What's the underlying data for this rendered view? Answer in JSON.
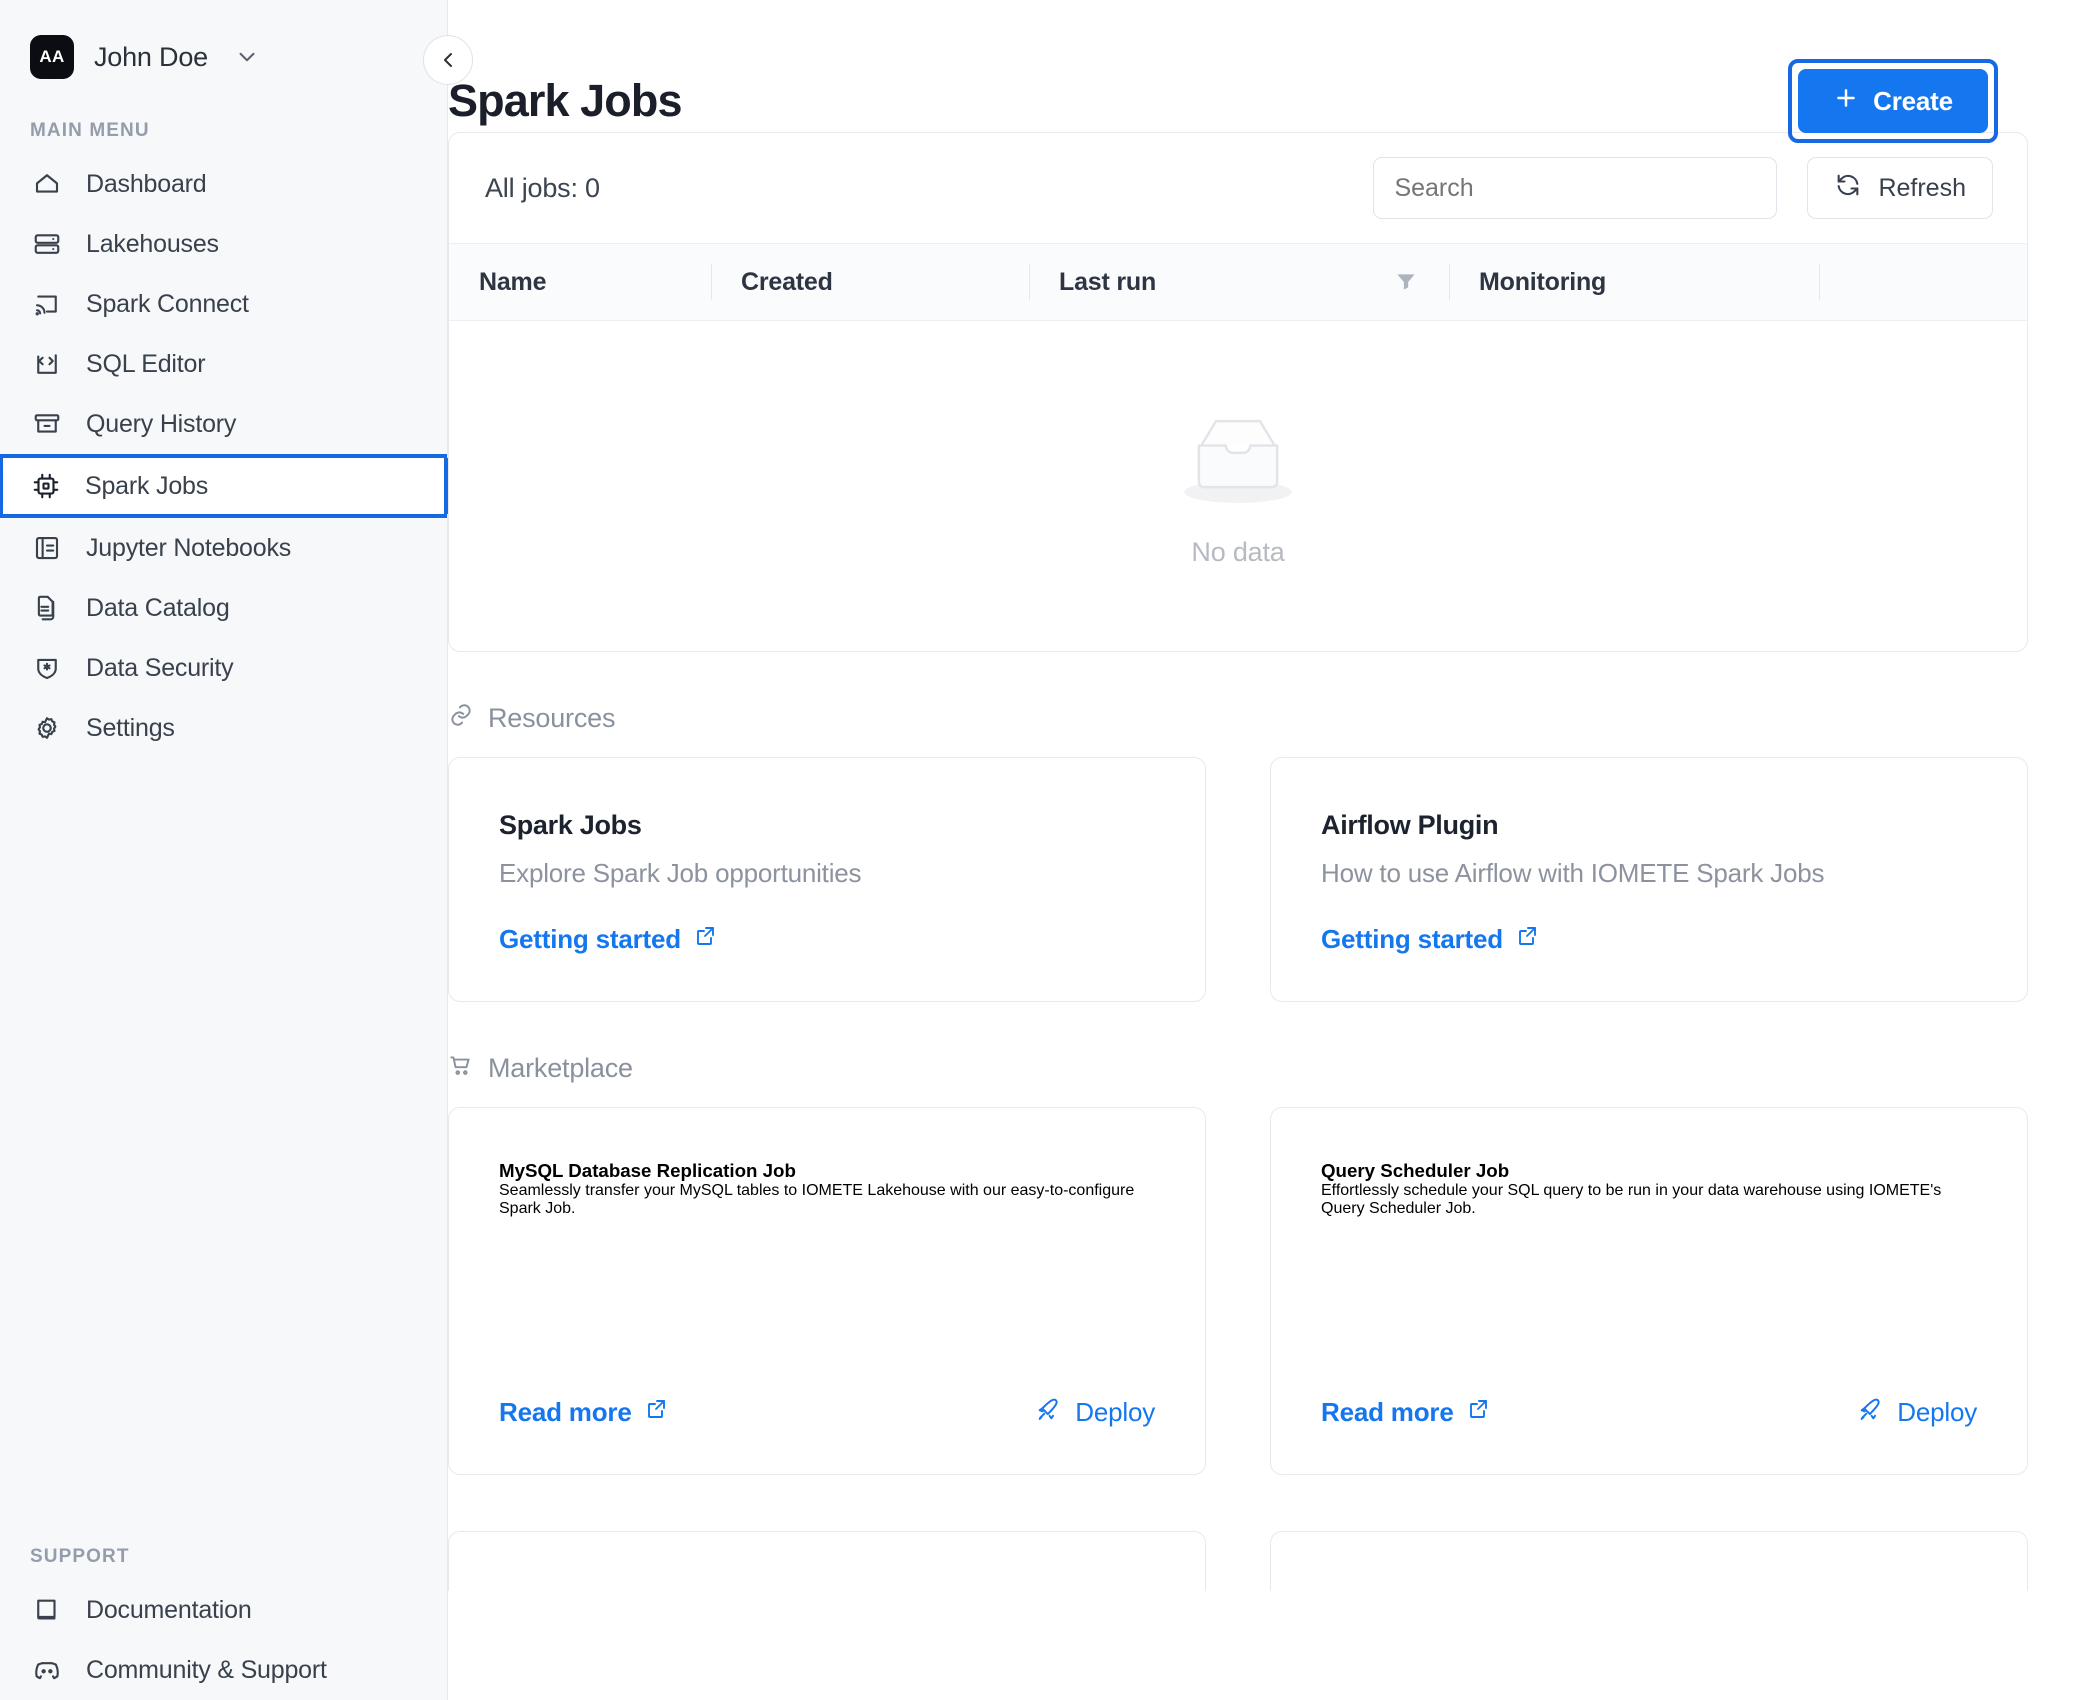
{
  "sidebar": {
    "user": {
      "initials": "AA",
      "name": "John Doe",
      "chevron_icon": "chevron-down-icon"
    },
    "collapse_icon": "chevron-left-icon",
    "main_menu_label": "MAIN MENU",
    "support_label": "SUPPORT",
    "items": [
      {
        "label": "Dashboard",
        "icon": "home-icon",
        "active": false
      },
      {
        "label": "Lakehouses",
        "icon": "server-icon",
        "active": false
      },
      {
        "label": "Spark Connect",
        "icon": "cast-icon",
        "active": false
      },
      {
        "label": "SQL Editor",
        "icon": "code-file-icon",
        "active": false
      },
      {
        "label": "Query History",
        "icon": "archive-icon",
        "active": false
      },
      {
        "label": "Spark Jobs",
        "icon": "cpu-icon",
        "active": true
      },
      {
        "label": "Jupyter Notebooks",
        "icon": "notebook-icon",
        "active": false
      },
      {
        "label": "Data Catalog",
        "icon": "documents-icon",
        "active": false
      },
      {
        "label": "Data Security",
        "icon": "shield-star-icon",
        "active": false
      },
      {
        "label": "Settings",
        "icon": "gear-icon",
        "active": false
      }
    ],
    "support_items": [
      {
        "label": "Documentation",
        "icon": "book-icon"
      },
      {
        "label": "Community & Support",
        "icon": "discord-icon"
      }
    ]
  },
  "header": {
    "title": "Spark Jobs",
    "create_label": "Create",
    "create_icon": "plus-icon",
    "accent_color": "#1577F0",
    "focus_color": "#1668E3"
  },
  "jobs_panel": {
    "count_label": "All jobs: 0",
    "search_placeholder": "Search",
    "search_value": "",
    "refresh_label": "Refresh",
    "refresh_icon": "refresh-icon",
    "filter_icon": "filter-icon",
    "columns": [
      "Name",
      "Created",
      "Last run",
      "Monitoring",
      ""
    ],
    "rows": [],
    "empty_text": "No data",
    "empty_icon": "empty-inbox-icon"
  },
  "resources": {
    "section_label": "Resources",
    "section_icon": "link-icon",
    "cards": [
      {
        "title": "Spark Jobs",
        "description": "Explore Spark Job opportunities",
        "link_label": "Getting started",
        "link_icon": "external-link-icon"
      },
      {
        "title": "Airflow Plugin",
        "description": "How to use Airflow with IOMETE Spark Jobs",
        "link_label": "Getting started",
        "link_icon": "external-link-icon"
      }
    ]
  },
  "marketplace": {
    "section_label": "Marketplace",
    "section_icon": "cart-icon",
    "cards": [
      {
        "title": "MySQL Database Replication Job",
        "description": "Seamlessly transfer your MySQL tables to IOMETE Lakehouse with our easy-to-configure Spark Job.",
        "link_label": "Read more",
        "link_icon": "external-link-icon",
        "action_label": "Deploy",
        "action_icon": "rocket-icon"
      },
      {
        "title": "Query Scheduler Job",
        "description": "Effortlessly schedule your SQL query to be run in your data warehouse using IOMETE's Query Scheduler Job.",
        "link_label": "Read more",
        "link_icon": "external-link-icon",
        "action_label": "Deploy",
        "action_icon": "rocket-icon"
      }
    ]
  }
}
